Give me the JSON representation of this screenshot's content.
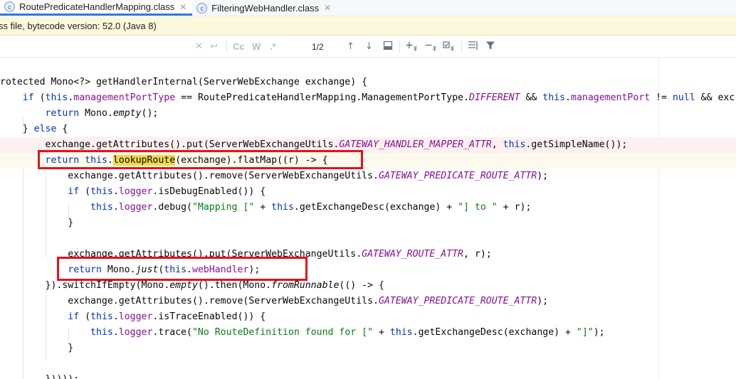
{
  "tabs": [
    {
      "label": "RoutePredicateHandlerMapping.class",
      "icon": "class-file-icon",
      "icon_glyph": "c",
      "active": true
    },
    {
      "label": "FilteringWebHandler.class",
      "icon": "class-file-icon",
      "icon_glyph": "c",
      "active": false
    }
  ],
  "banner": {
    "text": "ss file, bytecode version: 52.0 (Java 8)"
  },
  "findbar": {
    "match_case_label": "Cc",
    "words_label": "W",
    "regex_label": ".*",
    "match_count": "1/2"
  },
  "colors": {
    "keyword": "#0033b3",
    "field": "#871094",
    "string": "#067d17",
    "highlight": "#f2d94a",
    "annotation_box": "#e8101d"
  }
}
